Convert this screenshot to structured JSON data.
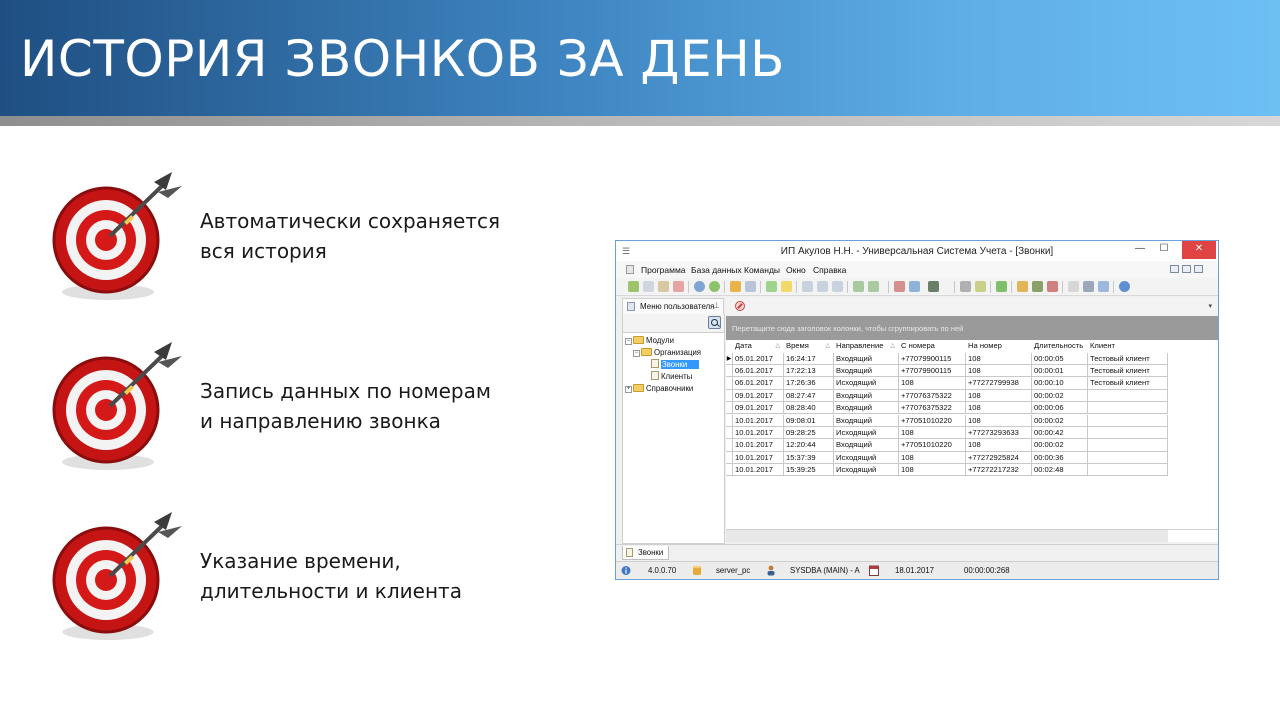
{
  "slide": {
    "title": "ИСТОРИЯ ЗВОНКОВ ЗА ДЕНЬ",
    "bullets": [
      {
        "line1": "Автоматически сохраняется",
        "line2": "вся история"
      },
      {
        "line1": "Запись данных по номерам",
        "line2": "и направлению звонка"
      },
      {
        "line1": "Указание времени,",
        "line2": "длительности и клиента"
      }
    ]
  },
  "window": {
    "title": "ИП Акулов Н.Н. - Универсальная Система Учета - [Звонки]",
    "controls": {
      "minimize": "—",
      "maximize": "☐",
      "close": "✕"
    },
    "menu": [
      "Программа",
      "База данных",
      "Команды",
      "Окно",
      "Справка"
    ],
    "left_panel": {
      "tab_label": "Меню пользователя",
      "pin": "⊥",
      "tree": [
        {
          "label": "Модули",
          "expander": "−"
        },
        {
          "label": "Организация",
          "expander": "−"
        },
        {
          "label": "Звонки"
        },
        {
          "label": "Клиенты"
        },
        {
          "label": "Справочники",
          "expander": "+"
        }
      ]
    },
    "grid": {
      "group_hint": "Перетащите сюда заголовок колонки, чтобы сгруппировать по ней",
      "sort_mark": "△",
      "current_row_marker": "▶",
      "columns": [
        "Дата",
        "Время",
        "Направление",
        "С номера",
        "На номер",
        "Длительность",
        "Клиент"
      ],
      "rows": [
        [
          "05.01.2017",
          "16:24:17",
          "Входящий",
          "+77079900115",
          "108",
          "00:00:05",
          "Тестовый клиент"
        ],
        [
          "06.01.2017",
          "17:22:13",
          "Входящий",
          "+77079900115",
          "108",
          "00:00:01",
          "Тестовый клиент"
        ],
        [
          "06.01.2017",
          "17:26:36",
          "Исходящий",
          "108",
          "+77272799938",
          "00:00:10",
          "Тестовый клиент"
        ],
        [
          "09.01.2017",
          "08:27:47",
          "Входящий",
          "+77076375322",
          "108",
          "00:00:02",
          ""
        ],
        [
          "09.01.2017",
          "08:28:40",
          "Входящий",
          "+77076375322",
          "108",
          "00:00:06",
          ""
        ],
        [
          "10.01.2017",
          "09:08:01",
          "Входящий",
          "+77051010220",
          "108",
          "00:00:02",
          ""
        ],
        [
          "10.01.2017",
          "09:28:25",
          "Исходящий",
          "108",
          "+77273293633",
          "00:00:42",
          ""
        ],
        [
          "10.01.2017",
          "12:20:44",
          "Входящий",
          "+77051010220",
          "108",
          "00:00:02",
          ""
        ],
        [
          "10.01.2017",
          "15:37:39",
          "Исходящий",
          "108",
          "+77272925824",
          "00:00:36",
          ""
        ],
        [
          "10.01.2017",
          "15:39:25",
          "Исходящий",
          "108",
          "+77272217232",
          "00:02:48",
          ""
        ]
      ]
    },
    "doc_tab": "Звонки",
    "status": {
      "version": "4.0.0.70",
      "server": "server_pc",
      "user": "SYSDBA (MAIN) - A",
      "date": "18.01.2017",
      "timer": "00:00:00:268"
    }
  }
}
